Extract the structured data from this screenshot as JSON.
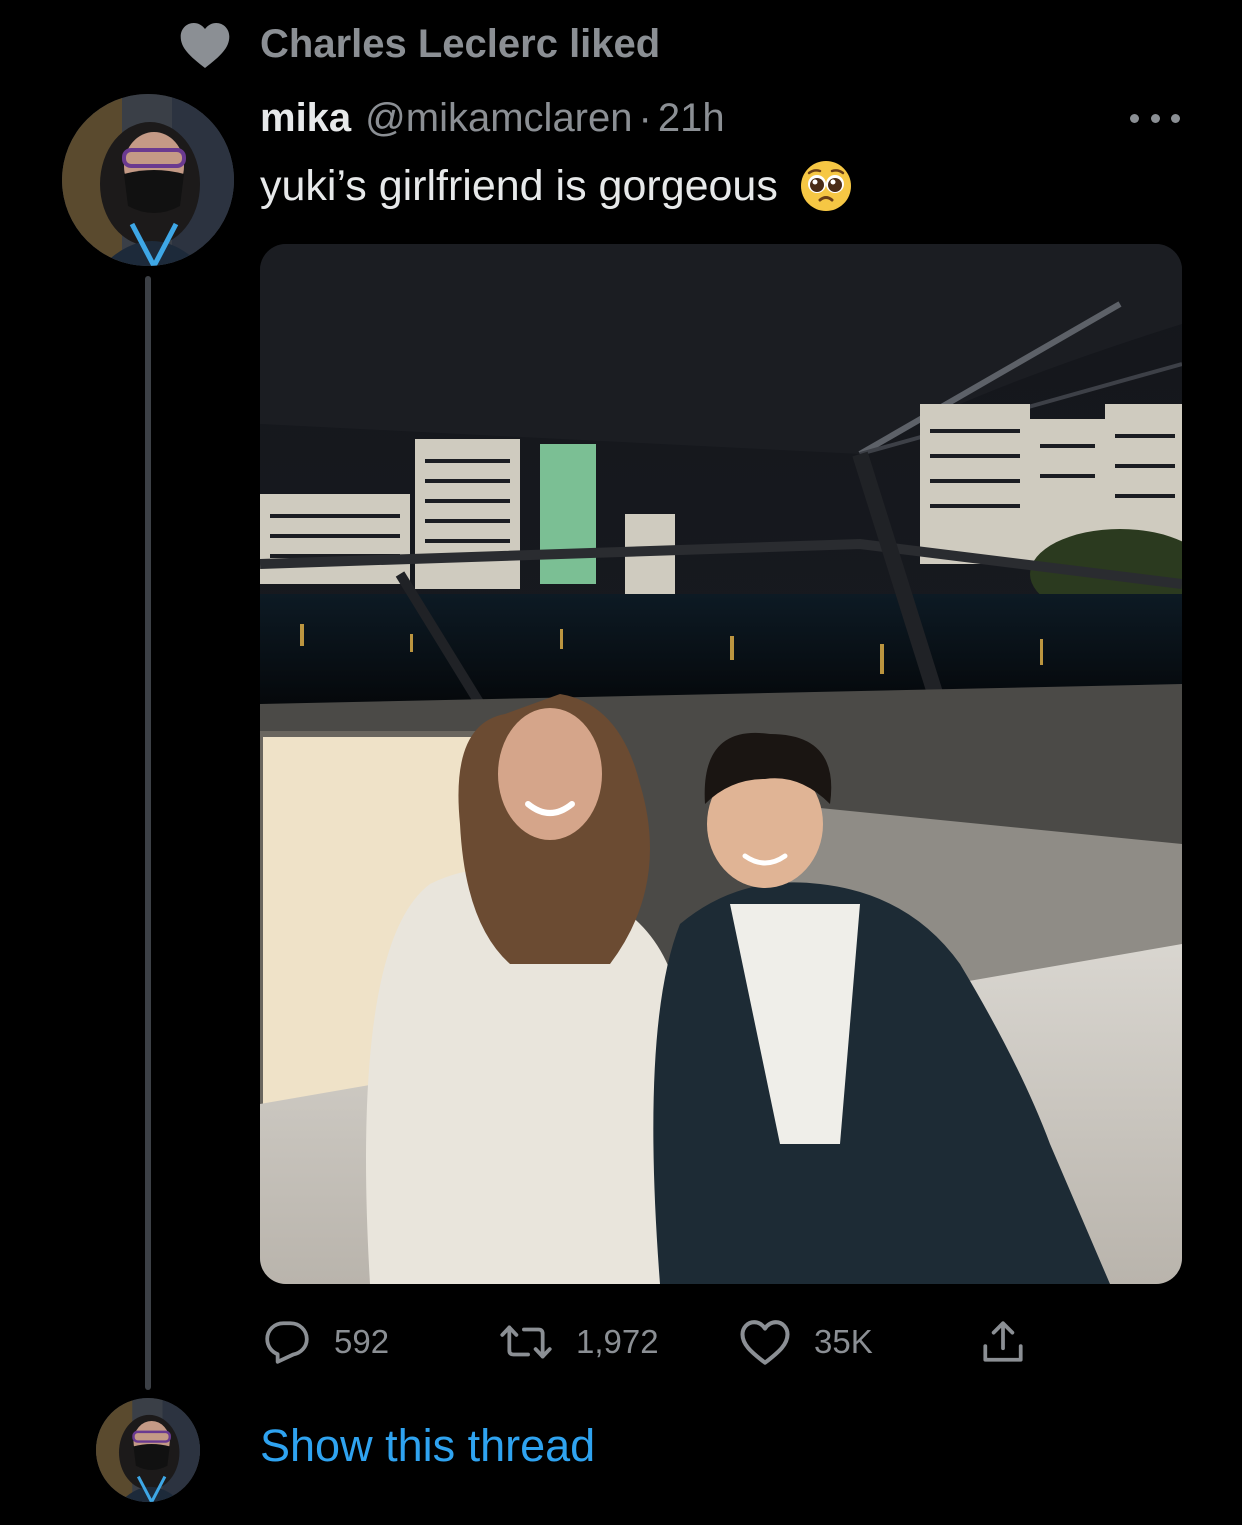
{
  "social_context": {
    "text": "Charles Leclerc liked",
    "icon": "heart-filled-icon"
  },
  "tweet": {
    "display_name": "mika",
    "handle": "@mikamclaren",
    "separator": "·",
    "time": "21h",
    "text": "yuki’s girlfriend is gorgeous",
    "emoji": "pleading-face-emoji",
    "more_icon": "more-horizontal-icon",
    "media": {
      "type": "photo",
      "subject": "two people seated on a boat at night with a city skyline behind"
    },
    "actions": {
      "reply_count": "592",
      "retweet_count": "1,972",
      "like_count": "35K",
      "reply_icon": "reply-icon",
      "retweet_icon": "retweet-icon",
      "like_icon": "heart-outline-icon",
      "share_icon": "share-icon"
    }
  },
  "thread_link": {
    "label": "Show this thread"
  },
  "colors": {
    "background": "#000000",
    "primary_text": "#e7e9ea",
    "secondary_text": "#8b8f94",
    "link": "#2fa3f0",
    "thread_line": "#3c4046"
  }
}
